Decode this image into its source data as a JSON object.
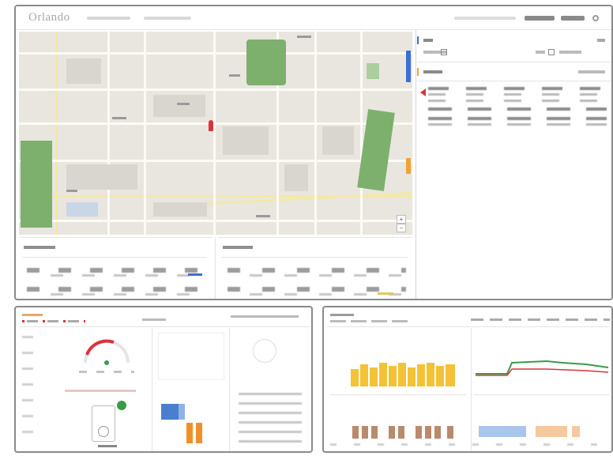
{
  "header": {
    "logo": "Orlando",
    "right_items": [
      "",
      "",
      ""
    ]
  },
  "map": {
    "zoom_in": "+",
    "zoom_out": "−"
  },
  "colors": {
    "accent_blue": "#3b6fd4",
    "accent_orange": "#f0a23a",
    "accent_red": "#d9343a",
    "park_green": "#7cb06c",
    "bar_yellow": "#f3c236",
    "bar_brown": "#b88b6c",
    "bar_lightblue": "#a9c5ea",
    "bar_peach": "#f4c9a0"
  },
  "right_panel": {
    "section_indicator_colors": [
      "#3b6fd4",
      "#f0a23a"
    ]
  },
  "bottom_left": {
    "gauge_color": "#d9343a",
    "bar_colors": [
      "#4a7fd0",
      "#f0902a"
    ]
  },
  "bottom_right": {
    "bar_colors": [
      "#f3c236",
      "#b88b6c",
      "#a9c5ea",
      "#f4c9a0"
    ]
  }
}
